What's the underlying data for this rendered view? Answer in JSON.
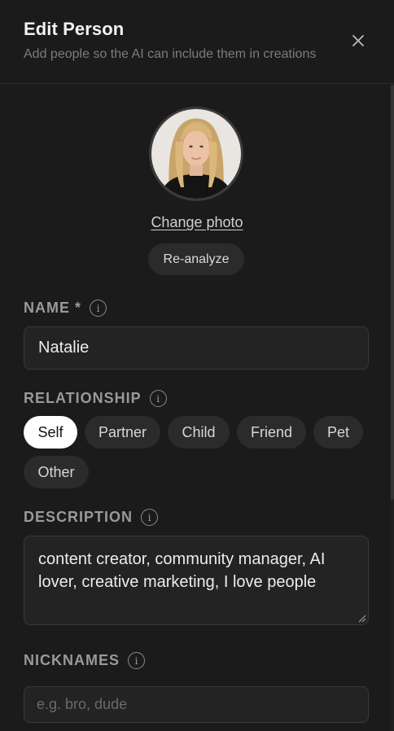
{
  "header": {
    "title": "Edit Person",
    "subtitle": "Add people so the AI can include them in creations"
  },
  "photo": {
    "change_label": "Change photo",
    "reanalyze_label": "Re-analyze"
  },
  "name": {
    "label": "NAME *",
    "value": "Natalie"
  },
  "relationship": {
    "label": "RELATIONSHIP",
    "options": [
      "Self",
      "Partner",
      "Child",
      "Friend",
      "Pet",
      "Other"
    ],
    "selected": "Self"
  },
  "description": {
    "label": "DESCRIPTION",
    "value": "content creator, community manager, AI lover, creative marketing, I love people"
  },
  "nicknames": {
    "label": "NICKNAMES",
    "placeholder": "e.g. bro, dude"
  },
  "icons": {
    "close": "close-icon",
    "info": "info-icon",
    "resize": "resize-handle-icon"
  },
  "colors": {
    "background": "#1b1b1b",
    "chip_selected": "#ffffff",
    "chip": "#2b2b2b"
  }
}
